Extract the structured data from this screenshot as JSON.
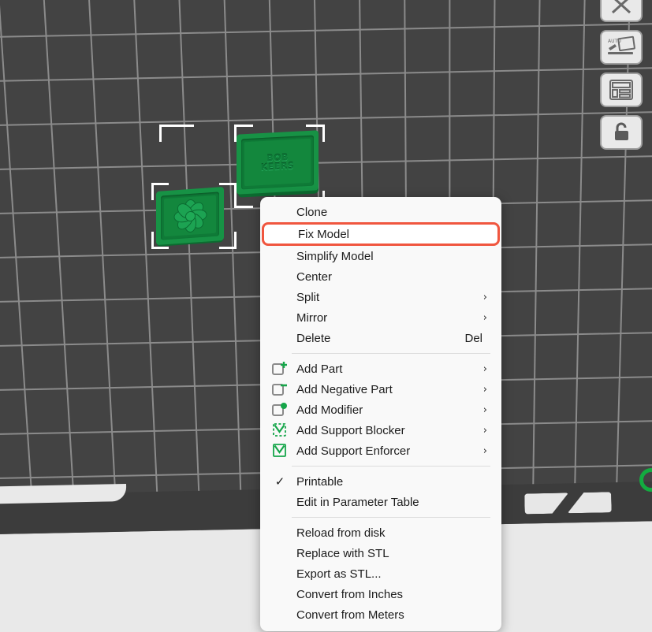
{
  "app": {
    "name": "3d-print-slicer-viewport"
  },
  "viewport": {
    "plate_label": "build-plate",
    "models": [
      {
        "id": "model-flower",
        "label": "flower-relief-plaque",
        "selected": true,
        "color": "#179245"
      },
      {
        "id": "model-keers",
        "label": "bob-keers-plaque",
        "selected": true,
        "color": "#179245",
        "embossed_line1": "BOB",
        "embossed_line2": "KEERS"
      }
    ]
  },
  "toolbar": {
    "buttons": [
      {
        "name": "close-button",
        "icon": "close-icon",
        "title": "Close"
      },
      {
        "name": "auto-arrange-button",
        "icon": "auto-arrange-icon",
        "title": "Auto arrange",
        "badge": "AUTO"
      },
      {
        "name": "layout-panel-button",
        "icon": "layout-panel-icon",
        "title": "Layout"
      },
      {
        "name": "lock-button",
        "icon": "unlock-icon",
        "title": "Unlock"
      }
    ]
  },
  "context_menu": {
    "highlight_color": "#f0563f",
    "groups": [
      {
        "items": [
          {
            "label": "Clone",
            "icon": null,
            "arrow": false,
            "shortcut": "",
            "check": false
          },
          {
            "label": "Fix Model",
            "icon": null,
            "arrow": false,
            "shortcut": "",
            "check": false,
            "highlighted": true
          },
          {
            "label": "Simplify Model",
            "icon": null,
            "arrow": false,
            "shortcut": "",
            "check": false
          },
          {
            "label": "Center",
            "icon": null,
            "arrow": false,
            "shortcut": "",
            "check": false
          },
          {
            "label": "Split",
            "icon": null,
            "arrow": true,
            "shortcut": "",
            "check": false
          },
          {
            "label": "Mirror",
            "icon": null,
            "arrow": true,
            "shortcut": "",
            "check": false
          },
          {
            "label": "Delete",
            "icon": null,
            "arrow": false,
            "shortcut": "Del",
            "check": false
          }
        ]
      },
      {
        "items": [
          {
            "label": "Add Part",
            "icon": "add-part-icon",
            "arrow": true,
            "shortcut": "",
            "check": false
          },
          {
            "label": "Add Negative Part",
            "icon": "add-negative-part-icon",
            "arrow": true,
            "shortcut": "",
            "check": false
          },
          {
            "label": "Add Modifier",
            "icon": "add-modifier-icon",
            "arrow": true,
            "shortcut": "",
            "check": false
          },
          {
            "label": "Add Support Blocker",
            "icon": "support-blocker-icon",
            "arrow": true,
            "shortcut": "",
            "check": false
          },
          {
            "label": "Add Support Enforcer",
            "icon": "support-enforcer-icon",
            "arrow": true,
            "shortcut": "",
            "check": false
          }
        ]
      },
      {
        "items": [
          {
            "label": "Printable",
            "icon": null,
            "arrow": false,
            "shortcut": "",
            "check": true
          },
          {
            "label": "Edit in Parameter Table",
            "icon": null,
            "arrow": false,
            "shortcut": "",
            "check": false
          }
        ]
      },
      {
        "items": [
          {
            "label": "Reload from disk",
            "icon": null,
            "arrow": false,
            "shortcut": "",
            "check": false
          },
          {
            "label": "Replace with STL",
            "icon": null,
            "arrow": false,
            "shortcut": "",
            "check": false
          },
          {
            "label": "Export as STL...",
            "icon": null,
            "arrow": false,
            "shortcut": "",
            "check": false
          },
          {
            "label": "Convert from Inches",
            "icon": null,
            "arrow": false,
            "shortcut": "",
            "check": false
          },
          {
            "label": "Convert from Meters",
            "icon": null,
            "arrow": false,
            "shortcut": "",
            "check": false
          }
        ]
      }
    ]
  },
  "colors": {
    "plate": "#3c3c3c",
    "plate_surface": "#434343",
    "grid_line": "#8b8b8b",
    "model_green": "#179245",
    "accent_red": "#f0563f",
    "menu_bg": "#f9f9f9",
    "app_bg": "#e9e9e9"
  }
}
